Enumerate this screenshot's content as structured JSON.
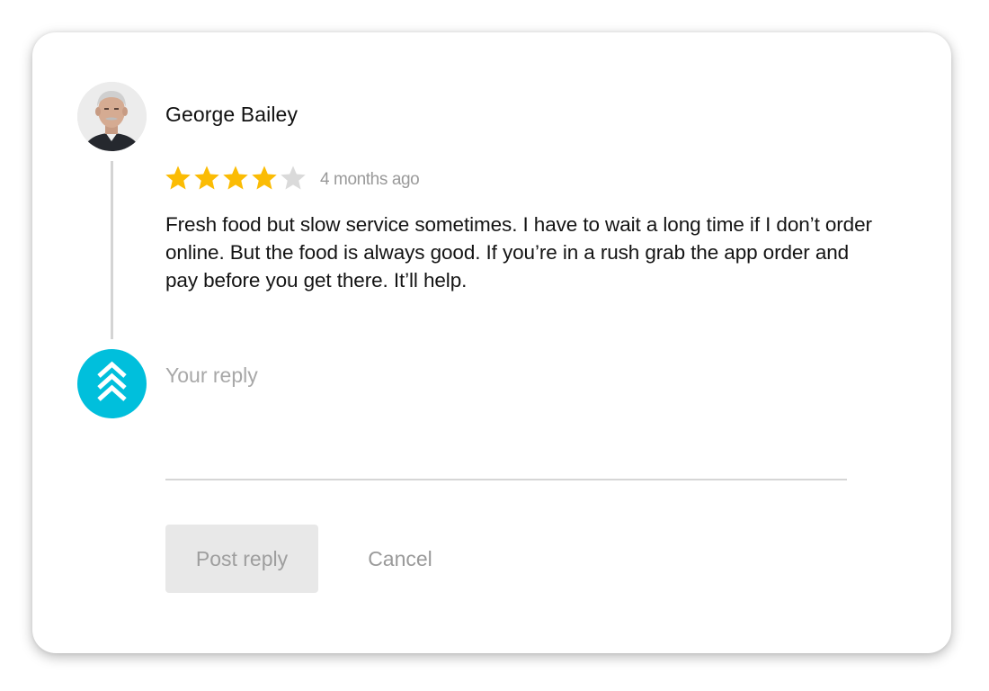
{
  "review": {
    "reviewer_name": "George Bailey",
    "avatar_icon": "person-photo",
    "rating": 4,
    "rating_max": 5,
    "time_ago": "4 months ago",
    "text": "Fresh food but slow service sometimes. I have to wait a long time if I don’t order online. But the food is always good. If you’re in a rush grab the app order and pay before you get there. It’ll help."
  },
  "reply": {
    "owner_icon": "chevrons-up-icon",
    "input_value": "",
    "placeholder": "Your reply",
    "post_label": "Post reply",
    "cancel_label": "Cancel"
  },
  "colors": {
    "star_filled": "#FBBC04",
    "star_empty": "#DADADA",
    "owner_accent": "#00BFDC",
    "post_button_bg": "#E8E8E8"
  }
}
